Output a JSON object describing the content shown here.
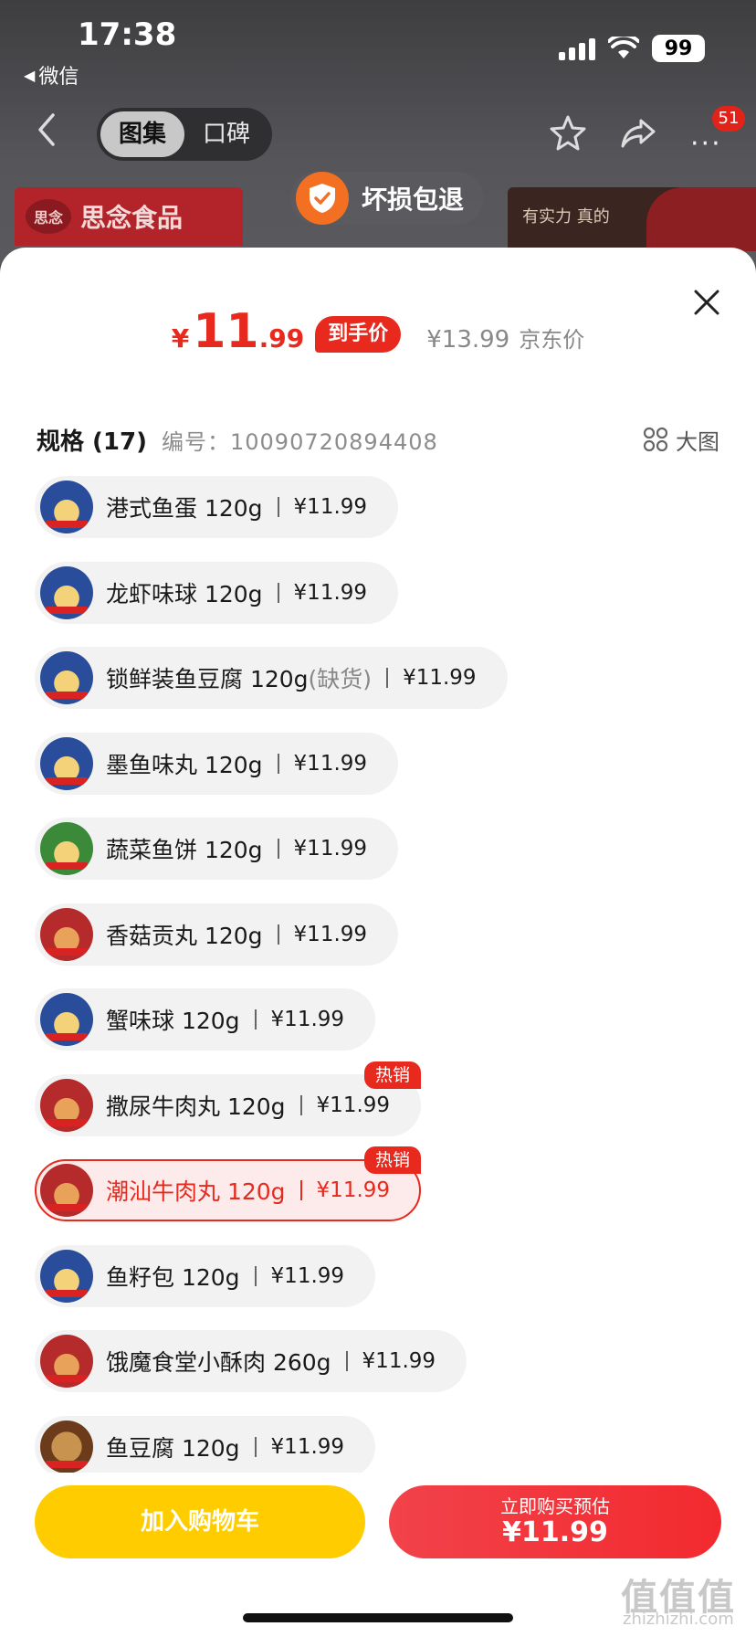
{
  "status_bar": {
    "time": "17:38",
    "back_app": "微信",
    "battery": "99"
  },
  "nav": {
    "tabs": [
      {
        "label": "图集",
        "active": true
      },
      {
        "label": "口碑",
        "active": false
      }
    ],
    "badge_count": "51",
    "more": "···"
  },
  "background": {
    "brand_name": "思念食品",
    "brand_logo_text": "思念",
    "guarantee_text": "坏损包退",
    "promo_text": "有实力 真的"
  },
  "price": {
    "currency": "¥",
    "integer": "11",
    "decimal": ".99",
    "tag": "到手价",
    "jd_price": "¥13.99",
    "jd_label": "京东价"
  },
  "spec": {
    "title": "规格 (17)",
    "code_label": "编号：",
    "code": "10090720894408",
    "big_view_label": "大图"
  },
  "items": [
    {
      "name": "港式鱼蛋 120g",
      "price": "¥11.99",
      "thumb": "blue"
    },
    {
      "name": "龙虾味球 120g",
      "price": "¥11.99",
      "thumb": "blue"
    },
    {
      "name": "锁鲜装鱼豆腐 120g",
      "suffix": "(缺货)",
      "price": "¥11.99",
      "thumb": "blue"
    },
    {
      "name": "墨鱼味丸 120g",
      "price": "¥11.99",
      "thumb": "blue"
    },
    {
      "name": "蔬菜鱼饼 120g",
      "price": "¥11.99",
      "thumb": "green"
    },
    {
      "name": "香菇贡丸 120g",
      "price": "¥11.99",
      "thumb": "red"
    },
    {
      "name": "蟹味球 120g",
      "price": "¥11.99",
      "thumb": "blue"
    },
    {
      "name": "撒尿牛肉丸 120g",
      "price": "¥11.99",
      "thumb": "red",
      "badge": "热销"
    },
    {
      "name": "潮汕牛肉丸 120g",
      "price": "¥11.99",
      "thumb": "red",
      "badge": "热销",
      "selected": true
    },
    {
      "name": "鱼籽包 120g",
      "price": "¥11.99",
      "thumb": "blue"
    },
    {
      "name": "饿魔食堂小酥肉 260g",
      "price": "¥11.99",
      "thumb": "red"
    },
    {
      "name": "鱼豆腐 120g",
      "price": "¥11.99",
      "thumb": "brown"
    }
  ],
  "actions": {
    "add_to_cart": "加入购物车",
    "buy_label": "立即购买预估",
    "buy_price": "¥11.99"
  },
  "watermark": {
    "main": "值值值",
    "sub": "zhizhizhi.com"
  },
  "colors": {
    "accent": "#e8291e",
    "cart": "#ffcc00",
    "buy": "#f2424a"
  }
}
